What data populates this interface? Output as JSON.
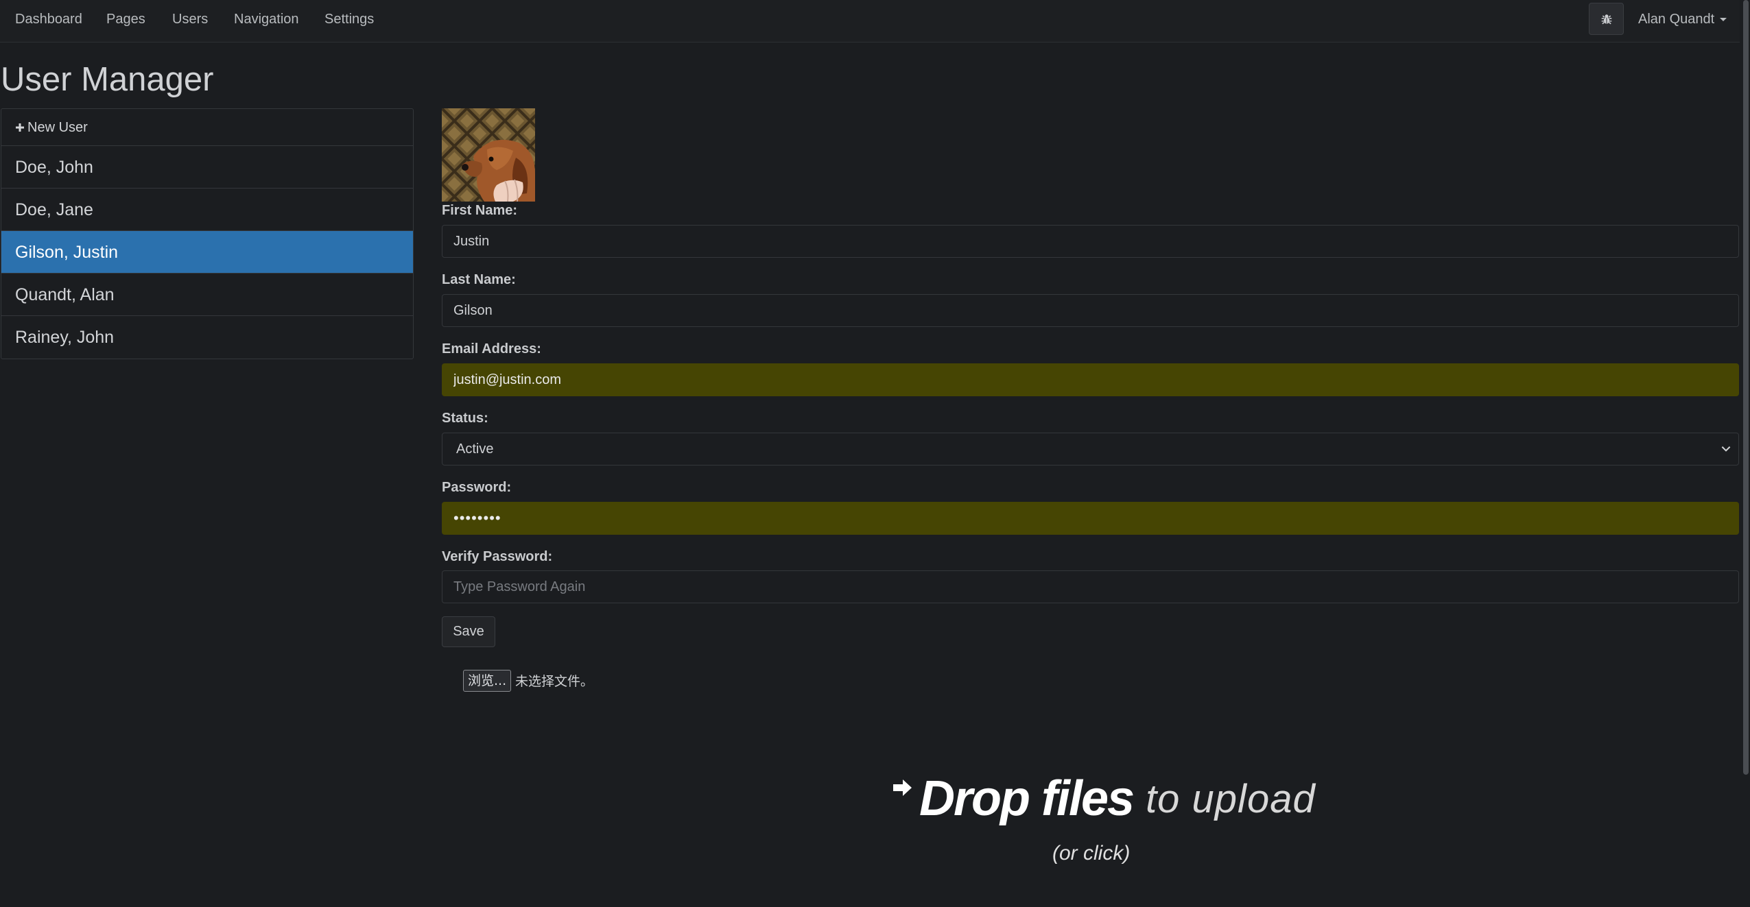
{
  "nav": {
    "items": [
      "Dashboard",
      "Pages",
      "Users",
      "Navigation",
      "Settings"
    ],
    "user_name": "Alan Quandt"
  },
  "page": {
    "title": "User Manager"
  },
  "user_list": {
    "new_user_label": "New User",
    "users": [
      "Doe, John",
      "Doe, Jane",
      "Gilson, Justin",
      "Quandt, Alan",
      "Rainey, John"
    ],
    "selected": "Gilson, Justin"
  },
  "form": {
    "first_name": {
      "label": "First Name:",
      "value": "Justin"
    },
    "last_name": {
      "label": "Last Name:",
      "value": "Gilson"
    },
    "email": {
      "label": "Email Address:",
      "value": "justin@justin.com"
    },
    "status": {
      "label": "Status:",
      "value": "Active"
    },
    "password": {
      "label": "Password:",
      "value": "••••••••"
    },
    "verify_password": {
      "label": "Verify Password:",
      "placeholder": "Type Password Again",
      "value": ""
    },
    "save_label": "Save"
  },
  "upload": {
    "browse_label": "浏览...",
    "no_file_text": "未选择文件。",
    "drop_strong": "Drop files",
    "drop_light": "to upload",
    "drop_sub": "(or click)"
  },
  "colors": {
    "active_item": "#2b71ae",
    "autofill": "#464503",
    "background": "#1b1d20"
  },
  "icons": [
    "bug-icon",
    "plus-icon",
    "chevron-down-icon",
    "arrow-right-icon",
    "caret-down-icon"
  ]
}
